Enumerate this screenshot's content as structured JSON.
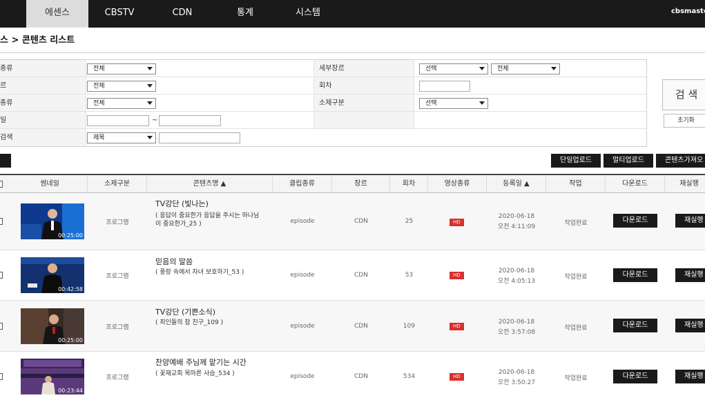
{
  "nav": {
    "tabs": [
      "에센스",
      "CBSTV",
      "CDN",
      "통계",
      "시스템"
    ],
    "active_tab": "에센스",
    "user": "cbsmaster"
  },
  "breadcrumb": "스 > 콘텐츠 리스트",
  "filter": {
    "row1_label": "종류",
    "row1_value": "전체",
    "row2_label": "르",
    "row2_value": "전체",
    "row3_label": "종류",
    "row3_value": "전체",
    "row4_label": "일",
    "row4_tilde": "~",
    "row5_label": "검색",
    "row5_value": "제목",
    "sub_genre_label": "세부장르",
    "sub_genre_value1": "선택",
    "sub_genre_value2": "전체",
    "episode_label": "회차",
    "subject_label": "소제구분",
    "subject_value": "선택",
    "search_button": "검 색",
    "reset_button": "초기화"
  },
  "actions": {
    "left_button": "",
    "single_upload": "단일업로드",
    "multi_upload": "멀티업로드",
    "import_contents": "콘텐츠가져오"
  },
  "table": {
    "headers": [
      "썸네일",
      "소제구분",
      "콘텐츠명 ▲",
      "클립종류",
      "장르",
      "회차",
      "영상종류",
      "등록일 ▲",
      "작업",
      "다운로드",
      "재실행"
    ],
    "rows": [
      {
        "duration": "00:25:00",
        "subject": "프로그램",
        "title": "TV강단 (빛나는)",
        "subtitle": "( 응답이 중요한가 응답을 주시는 하나님이 중요한가_25 )",
        "clip": "episode",
        "genre": "CDN",
        "episode": "25",
        "video": "HD",
        "date": "2020-06-18",
        "time": "오전 4:11:09",
        "status": "작업완료",
        "download": "다운로드",
        "rerun": "재실행"
      },
      {
        "duration": "00:42:58",
        "subject": "프로그램",
        "title": "믿음의 말씀",
        "subtitle": "( 풍랑 속에서 자녀 보호하기_53 )",
        "clip": "episode",
        "genre": "CDN",
        "episode": "53",
        "video": "HD",
        "date": "2020-06-18",
        "time": "오전 4:05:13",
        "status": "작업완료",
        "download": "다운로드",
        "rerun": "재실행"
      },
      {
        "duration": "00:25:00",
        "subject": "프로그램",
        "title": "TV강단 (기쁜소식)",
        "subtitle": "( 죄인들의 참 친구_109 )",
        "clip": "episode",
        "genre": "CDN",
        "episode": "109",
        "video": "HD",
        "date": "2020-06-18",
        "time": "오전 3:57:08",
        "status": "작업완료",
        "download": "다운로드",
        "rerun": "재실행"
      },
      {
        "duration": "00:23:44",
        "subject": "프로그램",
        "title": "찬양예배 주님께 맡기는 시간",
        "subtitle": "( 꽃재교회 목마른 사슴_534 )",
        "clip": "episode",
        "genre": "CDN",
        "episode": "534",
        "video": "HD",
        "date": "2020-06-18",
        "time": "오전 3:50:27",
        "status": "작업완료",
        "download": "다운로드",
        "rerun": "재실행"
      }
    ]
  },
  "colors": {
    "nav_bg": "#1a1a1a",
    "hd_badge": "#d9302c",
    "button_bg": "#1a1a1a"
  }
}
